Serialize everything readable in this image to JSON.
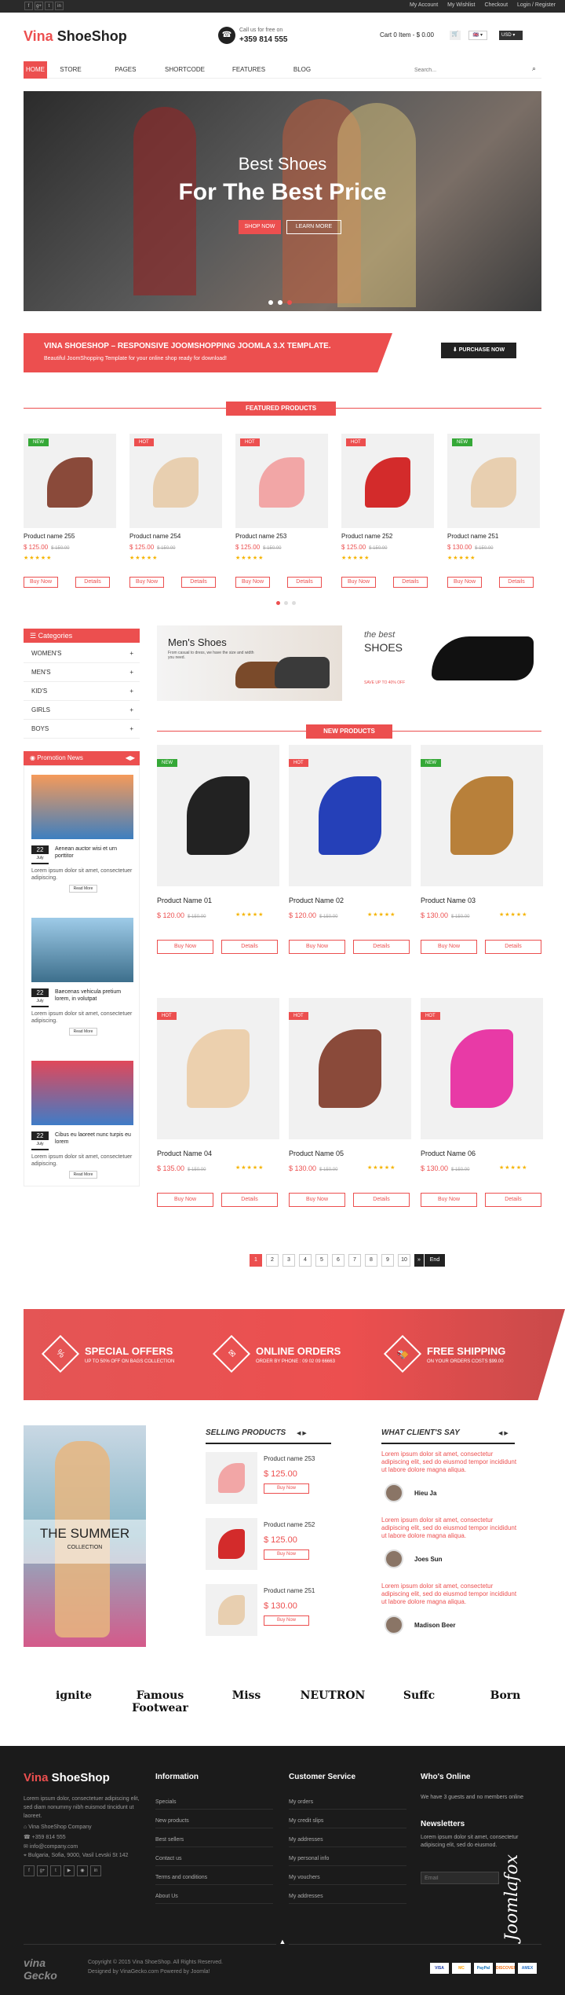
{
  "topbar": {
    "socials": [
      "f",
      "g+",
      "t",
      "in"
    ],
    "account": "My Account",
    "wishlist": "My Wishlist",
    "checkout": "Checkout",
    "login": "Login / Register"
  },
  "header": {
    "logo_a": "Vina ",
    "logo_b": "ShoeShop",
    "call_label": "Call us for free on",
    "phone": "+359 814 555",
    "cart": "Cart 0 Item - $ 0.00",
    "currency": "USD"
  },
  "menu": {
    "items": [
      "HOME",
      "STORE",
      "PAGES",
      "SHORTCODE",
      "FEATURES",
      "BLOG"
    ],
    "search_placeholder": "Search..."
  },
  "hero": {
    "line1": "Best Shoes",
    "line2": "For The Best Price",
    "btn1": "SHOP NOW",
    "btn2": "LEARN MORE"
  },
  "promo": {
    "title": "VINA SHOESHOP – RESPONSIVE JOOMSHOPPING JOOMLA 3.X TEMPLATE.",
    "sub": "Beautiful JoomShopping Template for your online shop ready for download!",
    "button": "PURCHASE NOW"
  },
  "featured": {
    "title": "FEATURED PRODUCTS",
    "products": [
      {
        "name": "Product name 255",
        "price": "$ 125.00",
        "old": "$ 150.00",
        "badge": "NEW"
      },
      {
        "name": "Product name 254",
        "price": "$ 125.00",
        "old": "$ 150.00",
        "badge": "HOT"
      },
      {
        "name": "Product name 253",
        "price": "$ 125.00",
        "old": "$ 150.00",
        "badge": "HOT"
      },
      {
        "name": "Product name 252",
        "price": "$ 125.00",
        "old": "$ 150.00",
        "badge": "HOT"
      },
      {
        "name": "Product name 251",
        "price": "$ 130.00",
        "old": "$ 150.00",
        "badge": "NEW"
      }
    ],
    "buy": "Buy Now",
    "details": "Details"
  },
  "categories": {
    "title": "Categories",
    "items": [
      "WOMEN'S",
      "MEN'S",
      "KID'S",
      "GIRLS",
      "BOYS"
    ]
  },
  "news": {
    "title": "Promotion News",
    "items": [
      {
        "day": "22",
        "mon": "July",
        "title": "Aenean auctor wisi et urn porttitor",
        "text": "Lorem ipsum dolor sit amet, consectetuer adipiscing.",
        "more": "Read More"
      },
      {
        "day": "22",
        "mon": "July",
        "title": "Baecenas vehicula pretium lorem, in volutpat",
        "text": "Lorem ipsum dolor sit amet, consectetuer adipiscing.",
        "more": "Read More"
      },
      {
        "day": "22",
        "mon": "July",
        "title": "Cibus eu laoreet nunc turpis eu lorem",
        "text": "Lorem ipsum dolor sit amet, consectetuer adipiscing.",
        "more": "Read More"
      }
    ]
  },
  "banners": {
    "men_title": "Men's Shoes",
    "men_sub": "From casual to dress, we have the size and width you need.",
    "best_a": "the best",
    "best_b": "SHOES",
    "best_c": "SAVE UP TO 40% OFF"
  },
  "newp": {
    "title": "NEW PRODUCTS",
    "products": [
      {
        "name": "Product Name 01",
        "price": "$ 120.00",
        "old": "$ 150.00",
        "badge": "NEW"
      },
      {
        "name": "Product Name 02",
        "price": "$ 120.00",
        "old": "$ 150.00",
        "badge": "HOT"
      },
      {
        "name": "Product Name 03",
        "price": "$ 130.00",
        "old": "$ 150.00",
        "badge": "NEW"
      },
      {
        "name": "Product Name 04",
        "price": "$ 135.00",
        "old": "$ 150.00",
        "badge": "HOT"
      },
      {
        "name": "Product Name 05",
        "price": "$ 130.00",
        "old": "$ 150.00",
        "badge": "HOT"
      },
      {
        "name": "Product Name 06",
        "price": "$ 130.00",
        "old": "$ 150.00",
        "badge": "HOT"
      }
    ],
    "buy": "Buy Now",
    "details": "Details"
  },
  "pagination": [
    "1",
    "2",
    "3",
    "4",
    "5",
    "6",
    "7",
    "8",
    "9",
    "10",
    "»",
    "End"
  ],
  "services": [
    {
      "title": "SPECIAL OFFERS",
      "sub": "UP TO 50% OFF ON BAGS COLLECTION"
    },
    {
      "title": "ONLINE ORDERS",
      "sub": "ORDER BY PHONE : 09 02 09 66663"
    },
    {
      "title": "FREE SHIPPING",
      "sub": "ON YOUR ORDERS COSTS $99.00"
    }
  ],
  "summer": {
    "a": "THE SUMMER",
    "b": "COLLECTION"
  },
  "selling": {
    "title": "SELLING PRODUCTS",
    "items": [
      {
        "name": "Product name 253",
        "price": "$ 125.00",
        "btn": "Buy Now"
      },
      {
        "name": "Product name 252",
        "price": "$ 125.00",
        "btn": "Buy Now"
      },
      {
        "name": "Product name 251",
        "price": "$ 130.00",
        "btn": "Buy Now"
      }
    ]
  },
  "clients": {
    "title": "WHAT CLIENT'S SAY",
    "items": [
      {
        "text": "Lorem ipsum dolor sit amet, consectetur adipiscing elit, sed do eiusmod tempor incididunt ut labore dolore magna aliqua.",
        "name": "Hieu Ja"
      },
      {
        "text": "Lorem ipsum dolor sit amet, consectetur adipiscing elit, sed do eiusmod tempor incididunt ut labore dolore magna aliqua.",
        "name": "Joes Sun"
      },
      {
        "text": "Lorem ipsum dolor sit amet, consectetur adipiscing elit, sed do eiusmod tempor incididunt ut labore dolore magna aliqua.",
        "name": "Madison Beer"
      }
    ]
  },
  "brands": [
    "ignite",
    "Famous Footwear",
    "Miss",
    "NEUTRON",
    "Suffc",
    "Born"
  ],
  "footer": {
    "about": "Lorem ipsum dolor, consectetuer adipiscing elit, sed diam nonummy nibh euismod tincidunt ut laoreet.",
    "company": "Vina ShoeShop Company",
    "phone": "+359 814 555",
    "email": "info@company.com",
    "address": "Bulgaria, Sofia, 9000, Vasil Levski St 142",
    "info_title": "Information",
    "info": [
      "Specials",
      "New products",
      "Best sellers",
      "Contact us",
      "Terms and conditions",
      "About Us"
    ],
    "cs_title": "Customer Service",
    "cs": [
      "My orders",
      "My credit slips",
      "My addresses",
      "My personal info",
      "My vouchers",
      "My addresses"
    ],
    "who_title": "Who's Online",
    "who_text": "We have 3 guests and no members online",
    "news_title": "Newsletters",
    "news_text": "Lorem ipsum dolor sit amet, consectetur adipiscing elit, sed do eiusmod.",
    "email_ph": "Email",
    "copy1": "Copyright © 2015 Vina ShoeShop. All Rights Reserved.",
    "copy2": "Designed by VinaGecko.com Powered by Joomla!",
    "payments": [
      "VISA",
      "MC",
      "PayPal",
      "DISCOVER",
      "AMEX"
    ],
    "brand_a": "Joomla",
    "brand_b": "fox"
  }
}
